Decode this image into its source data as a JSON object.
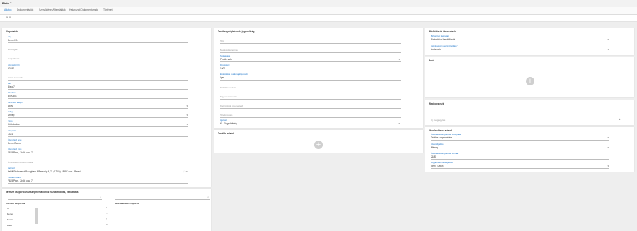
{
  "header": {
    "title": "Bisto 7"
  },
  "tabs": [
    {
      "label": "Adatok",
      "active": true
    },
    {
      "label": "Dokumentációk"
    },
    {
      "label": "Szerződések/Ütemtáblák"
    },
    {
      "label": "Határozati Dokumentumok"
    },
    {
      "label": "Történet"
    }
  ],
  "toolbar": {
    "edit_label": "✎ 0"
  },
  "alapadatok": {
    "title": "Alapadatok",
    "fields": [
      {
        "label": "Cég",
        "value": "Demo Kft."
      },
      {
        "placeholder": "Szövegek"
      },
      {
        "placeholder": "Cégváltozat"
      },
      {
        "label": "Azonosító (ID)",
        "value": "20287"
      },
      {
        "placeholder": "Külső azonosító"
      },
      {
        "label": "Név *",
        "value": "Bisto 7"
      },
      {
        "label": "Rövidnév",
        "value": "B020301"
      },
      {
        "label": "Dinamikus állapot",
        "value": "Aktív"
      },
      {
        "label": "Jelleg",
        "value": "Ünnep"
      },
      {
        "label": "Típus",
        "value": "Közlekedés"
      },
      {
        "label": "Irányszám",
        "value": "1023"
      },
      {
        "label": "Üzemeltető neve",
        "value": "Demo Demo"
      },
      {
        "label": "Üzemeltető címe",
        "value": "7625 Pécs, Jövök utca 7."
      },
      {
        "placeholder": "Üzemeltető további adatai"
      },
      {
        "label": "Helyrajzi",
        "value": "Jelölt Pedevrasul Bourgham Il Beszorig 4, 71 (17 Ya) - 8997 ccm - Biseki"
      },
      {
        "label": "Postai címszám",
        "value": "7625 Pécs, Jövök utca 7."
      }
    ]
  },
  "tevekenyseg": {
    "title": "Tevékenységleírások, jogosultság",
    "fields": [
      {
        "placeholder": "Tető"
      },
      {
        "placeholder": "Munkaidős norma"
      },
      {
        "label": "Szolgáltatás",
        "value": "Pro-Ac sala"
      },
      {
        "label": "Fizetés kód",
        "value": "1000"
      },
      {
        "label": "Elektronikus munkanapló jogosult",
        "value": "Igen"
      },
      {
        "placeholder": "Szállítási mutató"
      },
      {
        "placeholder": "Egyedi azonosító"
      },
      {
        "placeholder": "Kapcsolódó üzemeltető"
      },
      {
        "placeholder": "Telefonszám"
      },
      {
        "label": "Igazgató",
        "value": "K - Elégedettség"
      }
    ],
    "tovabbi": {
      "title": "További adatok"
    }
  },
  "minosites": {
    "title": "Minősítések, ütemezések",
    "fields": [
      {
        "label": "Biztosítóval kapcsolat",
        "value": "Biztosítóval került fizetni"
      },
      {
        "label": "Járműcsoport szerinti fizetőkép *",
        "value": "Automata"
      }
    ]
  },
  "fotok": {
    "title": "Fotó"
  },
  "megjegyzesek": {
    "title": "Megjegyzések",
    "placeholder": "Új megjegyzés"
  },
  "utoellenorzes": {
    "title": "Utóellenőrzési adatok",
    "fields": [
      {
        "label": "Üzemeltetési fogyasztás (rovat) fajta",
        "value": "Tétélés ámpermérés"
      },
      {
        "label": "Üzemidőjelölés",
        "value": "Mérleg"
      },
      {
        "label": "Üzemeltetési fogyasztás normája",
        "value": "2180"
      },
      {
        "label": "Fogyasztási mérőlegesítés *",
        "value": "liter / 100km"
      }
    ]
  },
  "csoportok": {
    "title": "Járművi csoportokhoz/szegmentációhoz hozzárendelés, változtatás",
    "available_label": "Elérhető csoportok",
    "assigned_label": "Hozzárendelt csoportok",
    "items": [
      "Id",
      "Demo",
      "Sostra",
      "Bodo"
    ]
  }
}
